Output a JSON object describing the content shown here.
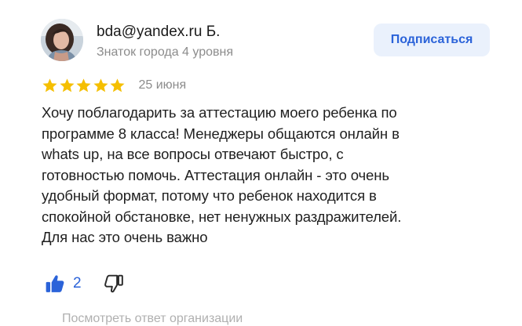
{
  "author": {
    "name": "bda@yandex.ru Б.",
    "level": "Знаток города 4 уровня",
    "avatar_icon": "user-photo-avatar"
  },
  "subscribe_button": {
    "label": "Подписаться"
  },
  "review": {
    "rating": 5,
    "rating_max": 5,
    "date": "25 июня",
    "text": "Хочу поблагодарить за аттестацию моего ребенка по\nпрограмме 8 класса! Менеджеры общаются онлайн в\nwhats up, на все вопросы отвечают быстро, с\nготовностью помочь. Аттестация онлайн - это очень\nудобный формат, потому что ребенок находится  в\nспокойной обстановке, нет ненужных раздражителей.\nДля нас это очень важно"
  },
  "reactions": {
    "likes": "2",
    "like_icon": "thumbs-up-filled-icon",
    "dislike_icon": "thumbs-down-outline-icon"
  },
  "org_reply_link": {
    "label": "Посмотреть ответ организации"
  },
  "colors": {
    "star": "#f5bf00",
    "accent_blue": "#2b63d9",
    "button_bg": "#eaf1fc",
    "muted_text": "#8c8c8c"
  }
}
